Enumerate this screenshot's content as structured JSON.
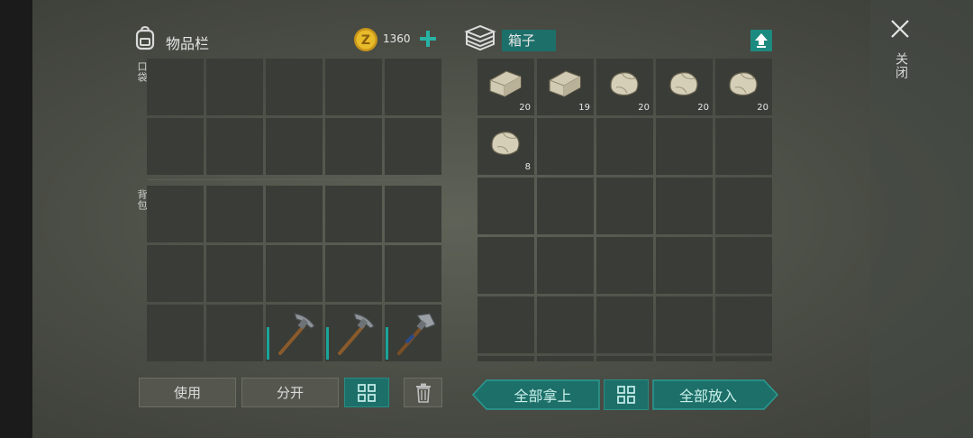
{
  "inventory": {
    "title": "物品栏",
    "currency_amount": "1360",
    "pocket_label": "口袋",
    "backpack_label": "背包",
    "backpack_items": [
      {
        "slot": 12,
        "item": "pickaxe-icon",
        "durability": 0.6
      },
      {
        "slot": 13,
        "item": "pickaxe-icon",
        "durability": 0.6
      },
      {
        "slot": 14,
        "item": "hatchet-icon",
        "durability": 0.6
      }
    ]
  },
  "box": {
    "title": "箱子",
    "items": [
      {
        "item": "stone-block-icon",
        "count": "20"
      },
      {
        "item": "stone-block-icon",
        "count": "19"
      },
      {
        "item": "stone-rock-icon",
        "count": "20"
      },
      {
        "item": "stone-rock-icon",
        "count": "20"
      },
      {
        "item": "stone-rock-icon",
        "count": "20"
      },
      {
        "item": "stone-rock-icon",
        "count": "8"
      }
    ]
  },
  "buttons": {
    "use": "使用",
    "split": "分开",
    "take_all": "全部拿上",
    "put_all": "全部放入"
  },
  "close_label": "关闭",
  "colors": {
    "accent": "#1d6f69",
    "plus": "#27b3a5",
    "coin": "#e1b422"
  }
}
